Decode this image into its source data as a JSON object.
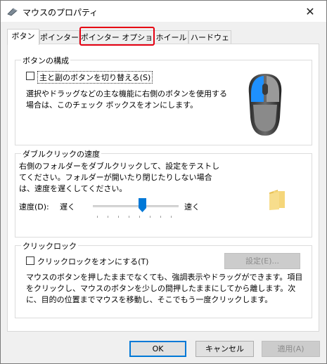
{
  "window": {
    "title": "マウスのプロパティ",
    "close": "✕"
  },
  "tabs": [
    {
      "label": "ボタン",
      "active": true
    },
    {
      "label": "ポインター"
    },
    {
      "label": "ポインター オプション",
      "highlighted": true
    },
    {
      "label": "ホイール"
    },
    {
      "label": "ハードウェア"
    }
  ],
  "button_config": {
    "title": "ボタンの構成",
    "swap_checkbox_label": "主と副のボタンを切り替える(S)",
    "swap_checked": false,
    "description": "選択やドラッグなどの主な機能に右側のボタンを使用する場合は、このチェック ボックスをオンにします。"
  },
  "double_click": {
    "title": "ダブルクリックの速度",
    "description": "右側のフォルダーをダブルクリックして、設定をテストしてください。フォルダーが開いたり閉じたりしない場合は、速度を遅くしてください。",
    "speed_label": "速度(D):",
    "slow_label": "遅く",
    "fast_label": "速く",
    "slider_value_fraction": 0.5
  },
  "click_lock": {
    "title": "クリックロック",
    "checkbox_label": "クリックロックをオンにする(T)",
    "checked": false,
    "settings_button": "設定(E)...",
    "description": "マウスのボタンを押したままでなくても、強調表示やドラッグができます。項目をクリックし、マウスのボタンを少しの間押したままにしてから離します。次に、目的の位置までマウスを移動し、そこでもう一度クリックします。"
  },
  "footer": {
    "ok": "OK",
    "cancel": "キャンセル",
    "apply": "適用(A)"
  },
  "colors": {
    "accent": "#0078d7",
    "highlight": "#e60012",
    "folder": "#f5d67a"
  }
}
